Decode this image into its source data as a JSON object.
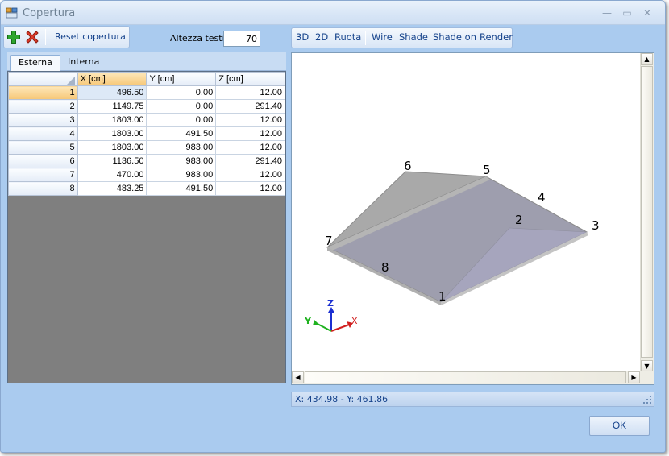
{
  "window": {
    "title": "Copertura",
    "accent": "#aacbef"
  },
  "toolbar": {
    "add_icon": "plus-icon",
    "delete_icon": "delete-x-icon",
    "reset_label": "Reset copertura",
    "altezza_label": "Altezza testi",
    "altezza_value": "70"
  },
  "tabs": [
    {
      "label": "Esterna",
      "active": true
    },
    {
      "label": "Interna",
      "active": false
    }
  ],
  "grid": {
    "columns": [
      "X [cm]",
      "Y [cm]",
      "Z [cm]"
    ],
    "selected_row": 1,
    "rows": [
      {
        "n": "1",
        "x": "496.50",
        "y": "0.00",
        "z": "12.00"
      },
      {
        "n": "2",
        "x": "1149.75",
        "y": "0.00",
        "z": "291.40"
      },
      {
        "n": "3",
        "x": "1803.00",
        "y": "0.00",
        "z": "12.00"
      },
      {
        "n": "4",
        "x": "1803.00",
        "y": "491.50",
        "z": "12.00"
      },
      {
        "n": "5",
        "x": "1803.00",
        "y": "983.00",
        "z": "12.00"
      },
      {
        "n": "6",
        "x": "1136.50",
        "y": "983.00",
        "z": "291.40"
      },
      {
        "n": "7",
        "x": "470.00",
        "y": "983.00",
        "z": "12.00"
      },
      {
        "n": "8",
        "x": "483.25",
        "y": "491.50",
        "z": "12.00"
      }
    ]
  },
  "view_toolbar": [
    "3D",
    "2D",
    "Ruota",
    "Wire",
    "Shade",
    "Shade on",
    "Render"
  ],
  "viewport": {
    "point_labels": [
      "1",
      "2",
      "3",
      "4",
      "5",
      "6",
      "7",
      "8"
    ],
    "axis_labels": [
      "Z",
      "Y",
      "X"
    ]
  },
  "status": {
    "coords": "X: 434.98 - Y: 461.86"
  },
  "ok_label": "OK"
}
